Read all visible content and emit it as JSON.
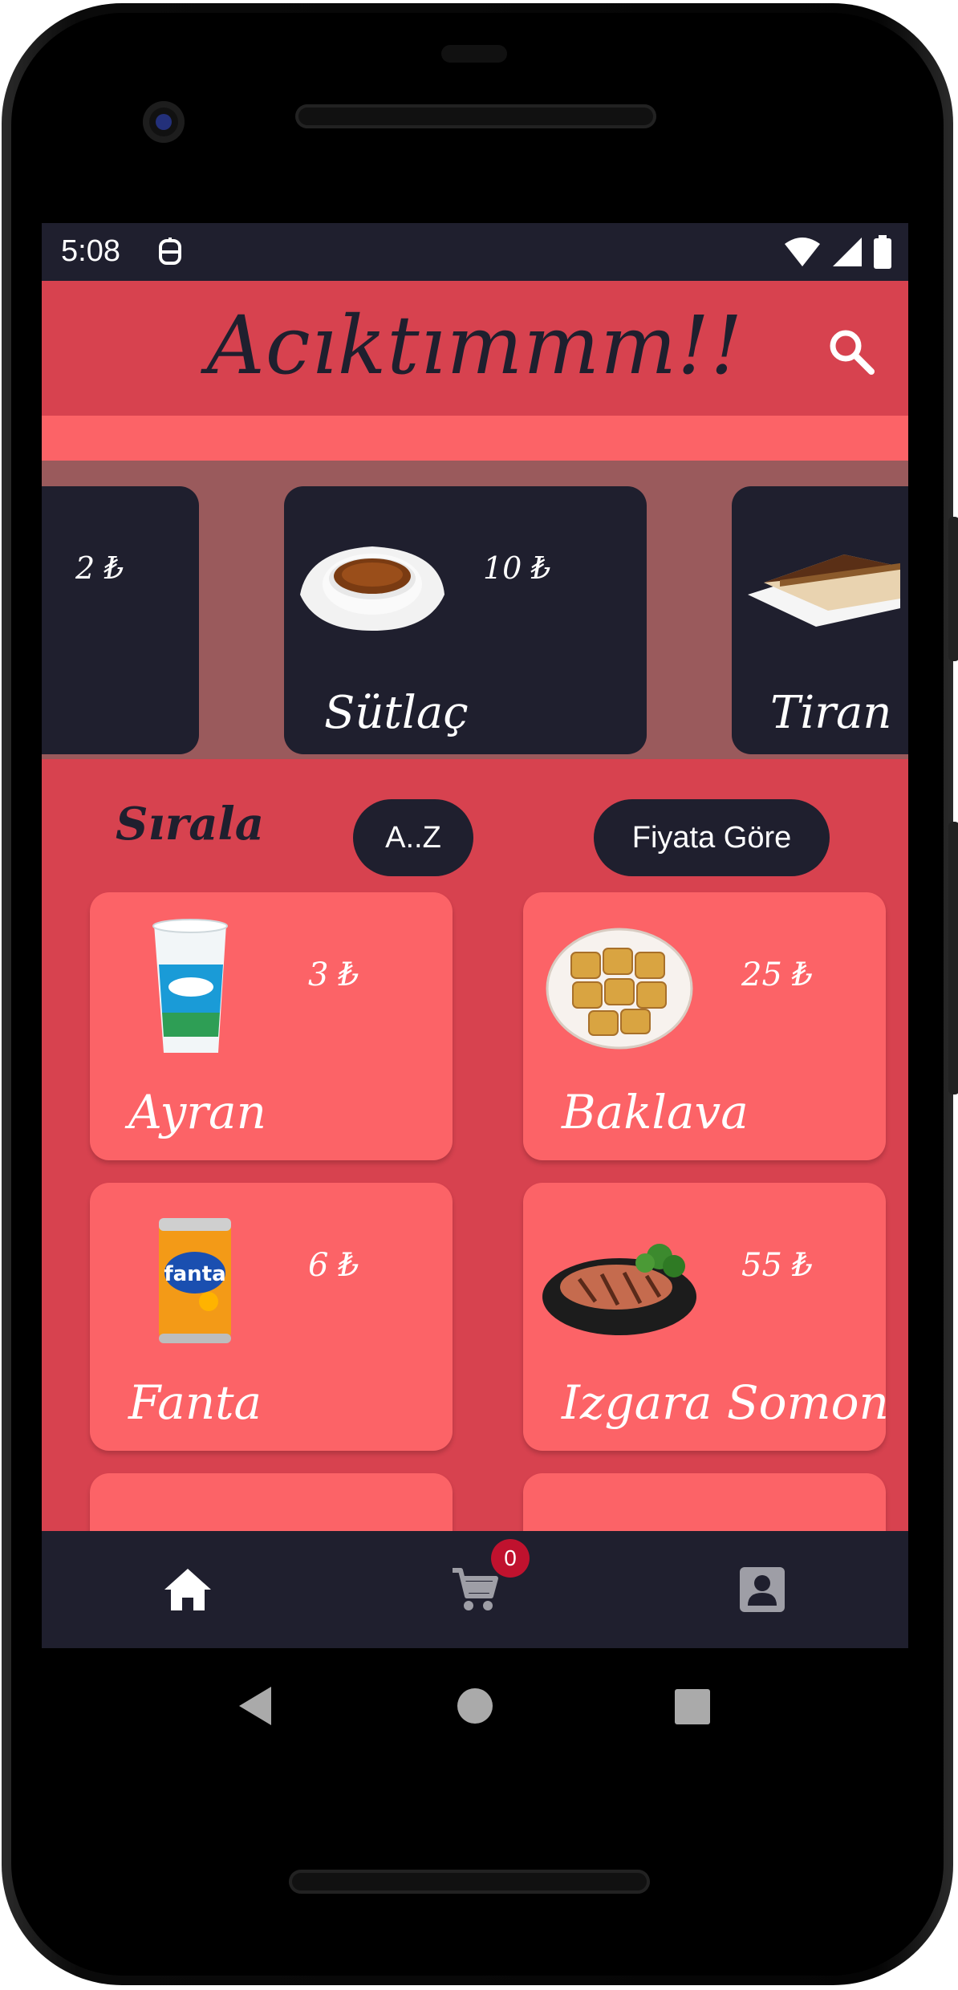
{
  "status_bar": {
    "time": "5:08"
  },
  "app_bar": {
    "title": "Acıktımmm!!"
  },
  "carousel": {
    "items": [
      {
        "name": "",
        "price": "2 ₺"
      },
      {
        "name": "Sütlaç",
        "price": "10 ₺"
      },
      {
        "name": "Tiran",
        "price": ""
      }
    ]
  },
  "sort": {
    "label": "Sırala",
    "az_label": "A..Z",
    "price_label": "Fiyata Göre"
  },
  "products": [
    {
      "name": "Ayran",
      "price": "3 ₺"
    },
    {
      "name": "Baklava",
      "price": "25 ₺"
    },
    {
      "name": "Fanta",
      "price": "6 ₺"
    },
    {
      "name": "Izgara Somon",
      "price": "55 ₺"
    }
  ],
  "bottom_nav": {
    "cart_count": "0"
  },
  "colors": {
    "primary": "#d7424f",
    "accent": "#fc6367",
    "dark": "#1f1f2e",
    "badge": "#c0122e"
  }
}
